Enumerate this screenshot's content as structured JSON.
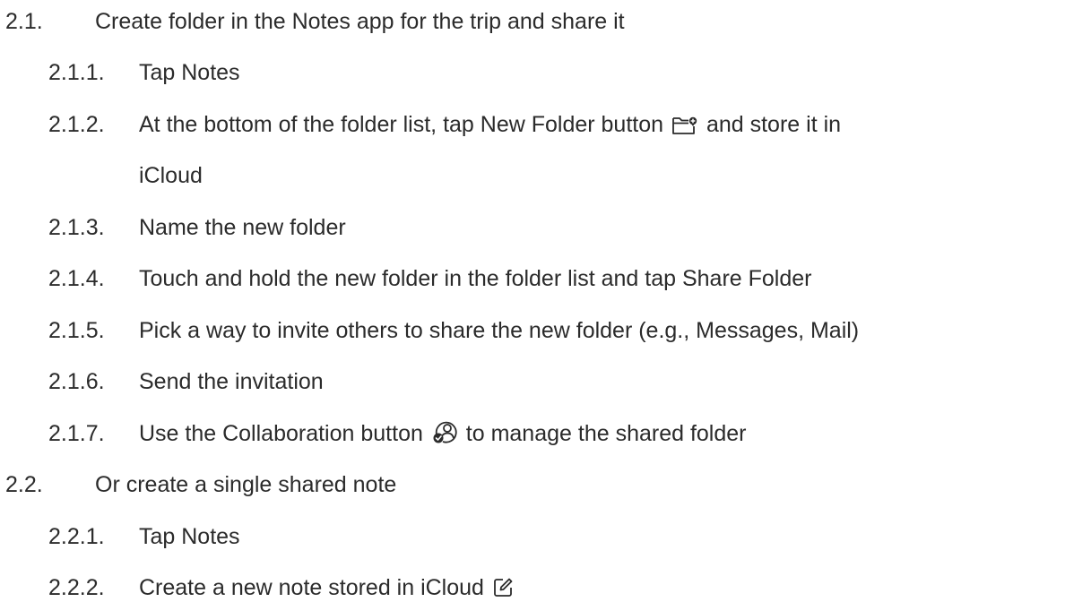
{
  "sections": [
    {
      "number": "2.1.",
      "text": "Create folder in the Notes app for the trip and share it",
      "steps": [
        {
          "number": "2.1.1.",
          "text": "Tap Notes"
        },
        {
          "number": "2.1.2.",
          "text_before": "At the bottom of the folder list, tap New Folder button",
          "icon": "new-folder-icon",
          "text_after": "and store it in",
          "continuation": "iCloud"
        },
        {
          "number": "2.1.3.",
          "text": "Name the new folder"
        },
        {
          "number": "2.1.4.",
          "text": "Touch and hold the new folder in the folder list and tap Share Folder"
        },
        {
          "number": "2.1.5.",
          "text": "Pick a way to invite others to share the new folder (e.g., Messages, Mail)"
        },
        {
          "number": "2.1.6.",
          "text": "Send the invitation"
        },
        {
          "number": "2.1.7.",
          "text_before": "Use the Collaboration button",
          "icon": "collaboration-icon",
          "text_after": "to manage the shared folder"
        }
      ]
    },
    {
      "number": "2.2.",
      "text": "Or create a single shared note",
      "steps": [
        {
          "number": "2.2.1.",
          "text": "Tap Notes"
        },
        {
          "number": "2.2.2.",
          "text_before": "Create a new note stored in iCloud",
          "icon": "compose-note-icon"
        }
      ]
    }
  ]
}
